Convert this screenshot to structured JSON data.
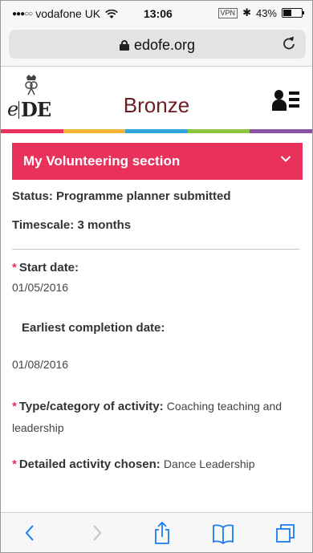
{
  "status_bar": {
    "signal": "●●●○○",
    "carrier": "vodafone UK",
    "time": "13:06",
    "vpn": "VPN",
    "bluetooth": "✱",
    "battery": "43%"
  },
  "browser": {
    "url": "edofe.org",
    "reload_icon": "reload-icon"
  },
  "header": {
    "logo_e": "e",
    "logo_de": "DE",
    "title": "Bronze"
  },
  "colors": {
    "accent": "#e8325c",
    "title": "#6b1f24",
    "rainbow": [
      "#e8325c",
      "#f2b233",
      "#2ea6de",
      "#8cc63f",
      "#8b4fa3"
    ]
  },
  "section": {
    "title": "My Volunteering section",
    "status": "Status: Programme planner submitted",
    "timescale": "Timescale: 3 months",
    "start_label": "Start date:",
    "start_value": "01/05/2016",
    "earliest_label": "Earliest completion date:",
    "earliest_value": "01/08/2016",
    "type_label": "Type/category of activity:",
    "type_value": "Coaching teaching and leadership",
    "activity_label": "Detailed activity chosen:",
    "activity_value": "Dance Leadership",
    "required_marker": "*"
  },
  "toolbar": {
    "back": "back-icon",
    "forward": "forward-icon",
    "share": "share-icon",
    "bookmarks": "bookmarks-icon",
    "tabs": "tabs-icon"
  }
}
